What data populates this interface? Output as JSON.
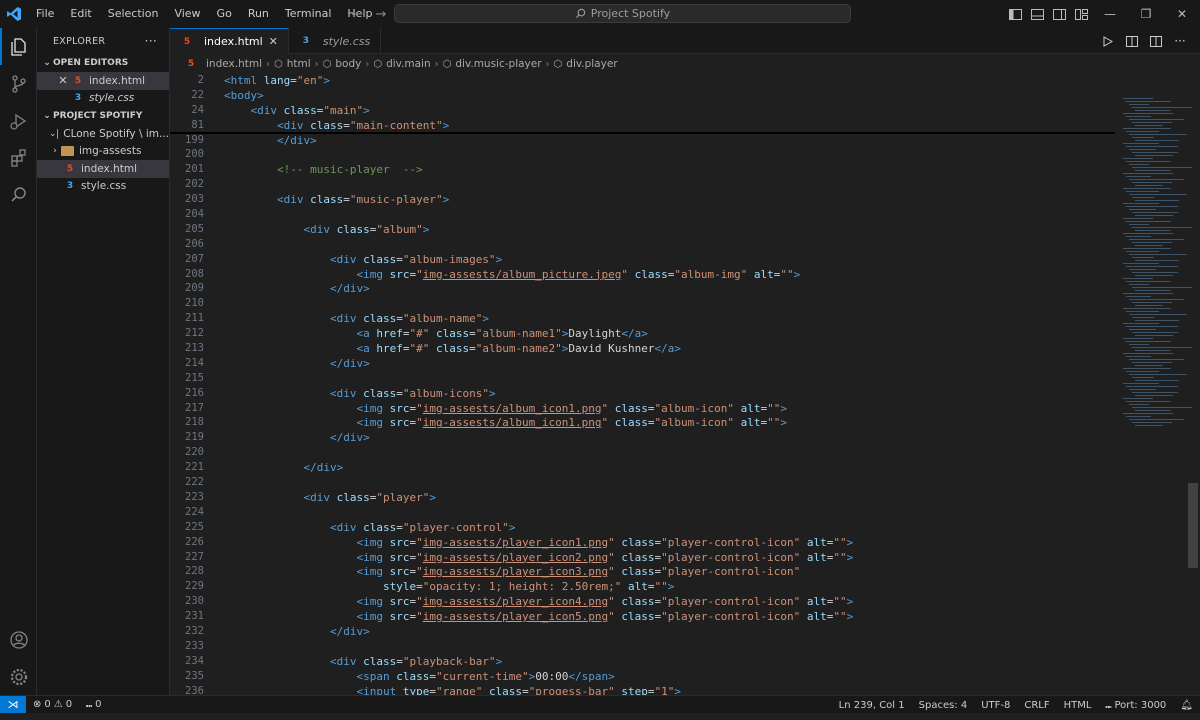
{
  "window": {
    "search_text": "Project Spotify",
    "menu": [
      "File",
      "Edit",
      "Selection",
      "View",
      "Go",
      "Run",
      "Terminal",
      "Help"
    ]
  },
  "sidebar": {
    "header": "EXPLORER",
    "open_editors_label": "OPEN EDITORS",
    "open_editors": [
      {
        "name": "index.html",
        "type": "html"
      },
      {
        "name": "style.css",
        "type": "css"
      }
    ],
    "project_label": "PROJECT SPOTIFY",
    "tree": [
      {
        "name": "CLone Spotify \\ im...",
        "type": "folder",
        "expanded": true
      },
      {
        "name": "img-assests",
        "type": "folder",
        "expanded": false
      },
      {
        "name": "index.html",
        "type": "html"
      },
      {
        "name": "style.css",
        "type": "css"
      }
    ]
  },
  "tabs": [
    {
      "label": "index.html",
      "active": true
    },
    {
      "label": "style.css",
      "active": false
    }
  ],
  "breadcrumbs": [
    "index.html",
    "html",
    "body",
    "div.main",
    "div.music-player",
    "div.player"
  ],
  "status": {
    "errors": "0",
    "warnings": "0",
    "ports": "0",
    "position": "Ln 239, Col 1",
    "spaces": "Spaces: 4",
    "encoding": "UTF-8",
    "eol": "CRLF",
    "language": "HTML",
    "port": "Port: 3000"
  },
  "colors": {
    "accent": "#0078d4",
    "tag": "#569cd6",
    "attr": "#9cdcfe",
    "string": "#ce9178",
    "comment": "#6a9955"
  },
  "code_lines": [
    {
      "n": "2",
      "sticky": true,
      "parts": [
        [
          "tg",
          "<html"
        ],
        [
          "tx",
          " "
        ],
        [
          "at",
          "lang"
        ],
        [
          "tx",
          "="
        ],
        [
          "st",
          "\"en\""
        ],
        [
          "tg",
          ">"
        ]
      ]
    },
    {
      "n": "22",
      "sticky": true,
      "parts": [
        [
          "tg",
          "<body>"
        ]
      ]
    },
    {
      "n": "24",
      "sticky": true,
      "parts": [
        [
          "tx",
          "    "
        ],
        [
          "tg",
          "<div"
        ],
        [
          "tx",
          " "
        ],
        [
          "at",
          "class"
        ],
        [
          "tx",
          "="
        ],
        [
          "st",
          "\"main\""
        ],
        [
          "tg",
          ">"
        ]
      ]
    },
    {
      "n": "81",
      "sticky": true,
      "last": true,
      "parts": [
        [
          "tx",
          "        "
        ],
        [
          "tg",
          "<div"
        ],
        [
          "tx",
          " "
        ],
        [
          "at",
          "class"
        ],
        [
          "tx",
          "="
        ],
        [
          "st",
          "\"main-content\""
        ],
        [
          "tg",
          ">"
        ]
      ]
    },
    {
      "n": "199",
      "parts": [
        [
          "tx",
          "        "
        ],
        [
          "tg",
          "</div>"
        ]
      ]
    },
    {
      "n": "200",
      "parts": []
    },
    {
      "n": "201",
      "parts": [
        [
          "tx",
          "        "
        ],
        [
          "cm",
          "<!-- music-player  -->"
        ]
      ]
    },
    {
      "n": "202",
      "parts": []
    },
    {
      "n": "203",
      "parts": [
        [
          "tx",
          "        "
        ],
        [
          "tg",
          "<div"
        ],
        [
          "tx",
          " "
        ],
        [
          "at",
          "class"
        ],
        [
          "tx",
          "="
        ],
        [
          "st",
          "\"music-player\""
        ],
        [
          "tg",
          ">"
        ]
      ]
    },
    {
      "n": "204",
      "parts": []
    },
    {
      "n": "205",
      "parts": [
        [
          "tx",
          "            "
        ],
        [
          "tg",
          "<div"
        ],
        [
          "tx",
          " "
        ],
        [
          "at",
          "class"
        ],
        [
          "tx",
          "="
        ],
        [
          "st",
          "\"album\""
        ],
        [
          "tg",
          ">"
        ]
      ]
    },
    {
      "n": "206",
      "parts": []
    },
    {
      "n": "207",
      "parts": [
        [
          "tx",
          "                "
        ],
        [
          "tg",
          "<div"
        ],
        [
          "tx",
          " "
        ],
        [
          "at",
          "class"
        ],
        [
          "tx",
          "="
        ],
        [
          "st",
          "\"album-images\""
        ],
        [
          "tg",
          ">"
        ]
      ]
    },
    {
      "n": "208",
      "parts": [
        [
          "tx",
          "                    "
        ],
        [
          "tg",
          "<img"
        ],
        [
          "tx",
          " "
        ],
        [
          "at",
          "src"
        ],
        [
          "tx",
          "="
        ],
        [
          "st",
          "\""
        ],
        [
          "stu",
          "img-assests/album_picture.jpeg"
        ],
        [
          "st",
          "\""
        ],
        [
          "tx",
          " "
        ],
        [
          "at",
          "class"
        ],
        [
          "tx",
          "="
        ],
        [
          "st",
          "\"album-img\""
        ],
        [
          "tx",
          " "
        ],
        [
          "at",
          "alt"
        ],
        [
          "tx",
          "="
        ],
        [
          "st",
          "\"\""
        ],
        [
          "tg",
          ">"
        ]
      ]
    },
    {
      "n": "209",
      "parts": [
        [
          "tx",
          "                "
        ],
        [
          "tg",
          "</div>"
        ]
      ]
    },
    {
      "n": "210",
      "parts": []
    },
    {
      "n": "211",
      "parts": [
        [
          "tx",
          "                "
        ],
        [
          "tg",
          "<div"
        ],
        [
          "tx",
          " "
        ],
        [
          "at",
          "class"
        ],
        [
          "tx",
          "="
        ],
        [
          "st",
          "\"album-name\""
        ],
        [
          "tg",
          ">"
        ]
      ]
    },
    {
      "n": "212",
      "parts": [
        [
          "tx",
          "                    "
        ],
        [
          "tg",
          "<a"
        ],
        [
          "tx",
          " "
        ],
        [
          "at",
          "href"
        ],
        [
          "tx",
          "="
        ],
        [
          "st",
          "\"#\""
        ],
        [
          "tx",
          " "
        ],
        [
          "at",
          "class"
        ],
        [
          "tx",
          "="
        ],
        [
          "st",
          "\"album-name1\""
        ],
        [
          "tg",
          ">"
        ],
        [
          "tx",
          "Daylight"
        ],
        [
          "tg",
          "</a>"
        ]
      ]
    },
    {
      "n": "213",
      "parts": [
        [
          "tx",
          "                    "
        ],
        [
          "tg",
          "<a"
        ],
        [
          "tx",
          " "
        ],
        [
          "at",
          "href"
        ],
        [
          "tx",
          "="
        ],
        [
          "st",
          "\"#\""
        ],
        [
          "tx",
          " "
        ],
        [
          "at",
          "class"
        ],
        [
          "tx",
          "="
        ],
        [
          "st",
          "\"album-name2\""
        ],
        [
          "tg",
          ">"
        ],
        [
          "tx",
          "David Kushner"
        ],
        [
          "tg",
          "</a>"
        ]
      ]
    },
    {
      "n": "214",
      "parts": [
        [
          "tx",
          "                "
        ],
        [
          "tg",
          "</div>"
        ]
      ]
    },
    {
      "n": "215",
      "parts": []
    },
    {
      "n": "216",
      "parts": [
        [
          "tx",
          "                "
        ],
        [
          "tg",
          "<div"
        ],
        [
          "tx",
          " "
        ],
        [
          "at",
          "class"
        ],
        [
          "tx",
          "="
        ],
        [
          "st",
          "\"album-icons\""
        ],
        [
          "tg",
          ">"
        ]
      ]
    },
    {
      "n": "217",
      "parts": [
        [
          "tx",
          "                    "
        ],
        [
          "tg",
          "<img"
        ],
        [
          "tx",
          " "
        ],
        [
          "at",
          "src"
        ],
        [
          "tx",
          "="
        ],
        [
          "st",
          "\""
        ],
        [
          "stu",
          "img-assests/album_icon1.png"
        ],
        [
          "st",
          "\""
        ],
        [
          "tx",
          " "
        ],
        [
          "at",
          "class"
        ],
        [
          "tx",
          "="
        ],
        [
          "st",
          "\"album-icon\""
        ],
        [
          "tx",
          " "
        ],
        [
          "at",
          "alt"
        ],
        [
          "tx",
          "="
        ],
        [
          "st",
          "\"\""
        ],
        [
          "tg",
          ">"
        ]
      ]
    },
    {
      "n": "218",
      "parts": [
        [
          "tx",
          "                    "
        ],
        [
          "tg",
          "<img"
        ],
        [
          "tx",
          " "
        ],
        [
          "at",
          "src"
        ],
        [
          "tx",
          "="
        ],
        [
          "st",
          "\""
        ],
        [
          "stu",
          "img-assests/album_icon1.png"
        ],
        [
          "st",
          "\""
        ],
        [
          "tx",
          " "
        ],
        [
          "at",
          "class"
        ],
        [
          "tx",
          "="
        ],
        [
          "st",
          "\"album-icon\""
        ],
        [
          "tx",
          " "
        ],
        [
          "at",
          "alt"
        ],
        [
          "tx",
          "="
        ],
        [
          "st",
          "\"\""
        ],
        [
          "tg",
          ">"
        ]
      ]
    },
    {
      "n": "219",
      "parts": [
        [
          "tx",
          "                "
        ],
        [
          "tg",
          "</div>"
        ]
      ]
    },
    {
      "n": "220",
      "parts": []
    },
    {
      "n": "221",
      "parts": [
        [
          "tx",
          "            "
        ],
        [
          "tg",
          "</div>"
        ]
      ]
    },
    {
      "n": "222",
      "parts": []
    },
    {
      "n": "223",
      "parts": [
        [
          "tx",
          "            "
        ],
        [
          "tg",
          "<div"
        ],
        [
          "tx",
          " "
        ],
        [
          "at",
          "class"
        ],
        [
          "tx",
          "="
        ],
        [
          "st",
          "\"player\""
        ],
        [
          "tg",
          ">"
        ]
      ]
    },
    {
      "n": "224",
      "parts": []
    },
    {
      "n": "225",
      "parts": [
        [
          "tx",
          "                "
        ],
        [
          "tg",
          "<div"
        ],
        [
          "tx",
          " "
        ],
        [
          "at",
          "class"
        ],
        [
          "tx",
          "="
        ],
        [
          "st",
          "\"player-control\""
        ],
        [
          "tg",
          ">"
        ]
      ]
    },
    {
      "n": "226",
      "parts": [
        [
          "tx",
          "                    "
        ],
        [
          "tg",
          "<img"
        ],
        [
          "tx",
          " "
        ],
        [
          "at",
          "src"
        ],
        [
          "tx",
          "="
        ],
        [
          "st",
          "\""
        ],
        [
          "stu",
          "img-assests/player_icon1.png"
        ],
        [
          "st",
          "\""
        ],
        [
          "tx",
          " "
        ],
        [
          "at",
          "class"
        ],
        [
          "tx",
          "="
        ],
        [
          "st",
          "\"player-control-icon\""
        ],
        [
          "tx",
          " "
        ],
        [
          "at",
          "alt"
        ],
        [
          "tx",
          "="
        ],
        [
          "st",
          "\"\""
        ],
        [
          "tg",
          ">"
        ]
      ]
    },
    {
      "n": "227",
      "parts": [
        [
          "tx",
          "                    "
        ],
        [
          "tg",
          "<img"
        ],
        [
          "tx",
          " "
        ],
        [
          "at",
          "src"
        ],
        [
          "tx",
          "="
        ],
        [
          "st",
          "\""
        ],
        [
          "stu",
          "img-assests/player_icon2.png"
        ],
        [
          "st",
          "\""
        ],
        [
          "tx",
          " "
        ],
        [
          "at",
          "class"
        ],
        [
          "tx",
          "="
        ],
        [
          "st",
          "\"player-control-icon\""
        ],
        [
          "tx",
          " "
        ],
        [
          "at",
          "alt"
        ],
        [
          "tx",
          "="
        ],
        [
          "st",
          "\"\""
        ],
        [
          "tg",
          ">"
        ]
      ]
    },
    {
      "n": "228",
      "parts": [
        [
          "tx",
          "                    "
        ],
        [
          "tg",
          "<img"
        ],
        [
          "tx",
          " "
        ],
        [
          "at",
          "src"
        ],
        [
          "tx",
          "="
        ],
        [
          "st",
          "\""
        ],
        [
          "stu",
          "img-assests/player_icon3.png"
        ],
        [
          "st",
          "\""
        ],
        [
          "tx",
          " "
        ],
        [
          "at",
          "class"
        ],
        [
          "tx",
          "="
        ],
        [
          "st",
          "\"player-control-icon\""
        ]
      ]
    },
    {
      "n": "229",
      "parts": [
        [
          "tx",
          "                        "
        ],
        [
          "at",
          "style"
        ],
        [
          "tx",
          "="
        ],
        [
          "st",
          "\"opacity: 1; height: 2.50rem;\""
        ],
        [
          "tx",
          " "
        ],
        [
          "at",
          "alt"
        ],
        [
          "tx",
          "="
        ],
        [
          "st",
          "\"\""
        ],
        [
          "tg",
          ">"
        ]
      ]
    },
    {
      "n": "230",
      "parts": [
        [
          "tx",
          "                    "
        ],
        [
          "tg",
          "<img"
        ],
        [
          "tx",
          " "
        ],
        [
          "at",
          "src"
        ],
        [
          "tx",
          "="
        ],
        [
          "st",
          "\""
        ],
        [
          "stu",
          "img-assests/player_icon4.png"
        ],
        [
          "st",
          "\""
        ],
        [
          "tx",
          " "
        ],
        [
          "at",
          "class"
        ],
        [
          "tx",
          "="
        ],
        [
          "st",
          "\"player-control-icon\""
        ],
        [
          "tx",
          " "
        ],
        [
          "at",
          "alt"
        ],
        [
          "tx",
          "="
        ],
        [
          "st",
          "\"\""
        ],
        [
          "tg",
          ">"
        ]
      ]
    },
    {
      "n": "231",
      "parts": [
        [
          "tx",
          "                    "
        ],
        [
          "tg",
          "<img"
        ],
        [
          "tx",
          " "
        ],
        [
          "at",
          "src"
        ],
        [
          "tx",
          "="
        ],
        [
          "st",
          "\""
        ],
        [
          "stu",
          "img-assests/player_icon5.png"
        ],
        [
          "st",
          "\""
        ],
        [
          "tx",
          " "
        ],
        [
          "at",
          "class"
        ],
        [
          "tx",
          "="
        ],
        [
          "st",
          "\"player-control-icon\""
        ],
        [
          "tx",
          " "
        ],
        [
          "at",
          "alt"
        ],
        [
          "tx",
          "="
        ],
        [
          "st",
          "\"\""
        ],
        [
          "tg",
          ">"
        ]
      ]
    },
    {
      "n": "232",
      "parts": [
        [
          "tx",
          "                "
        ],
        [
          "tg",
          "</div>"
        ]
      ]
    },
    {
      "n": "233",
      "parts": []
    },
    {
      "n": "234",
      "parts": [
        [
          "tx",
          "                "
        ],
        [
          "tg",
          "<div"
        ],
        [
          "tx",
          " "
        ],
        [
          "at",
          "class"
        ],
        [
          "tx",
          "="
        ],
        [
          "st",
          "\"playback-bar\""
        ],
        [
          "tg",
          ">"
        ]
      ]
    },
    {
      "n": "235",
      "parts": [
        [
          "tx",
          "                    "
        ],
        [
          "tg",
          "<span"
        ],
        [
          "tx",
          " "
        ],
        [
          "at",
          "class"
        ],
        [
          "tx",
          "="
        ],
        [
          "st",
          "\"current-time\""
        ],
        [
          "tg",
          ">"
        ],
        [
          "tx",
          "00:00"
        ],
        [
          "tg",
          "</span>"
        ]
      ]
    },
    {
      "n": "236",
      "parts": [
        [
          "tx",
          "                    "
        ],
        [
          "tg",
          "<input"
        ],
        [
          "tx",
          " "
        ],
        [
          "at",
          "type"
        ],
        [
          "tx",
          "="
        ],
        [
          "st",
          "\"range\""
        ],
        [
          "tx",
          " "
        ],
        [
          "at",
          "class"
        ],
        [
          "tx",
          "="
        ],
        [
          "st",
          "\"progess-bar\""
        ],
        [
          "tx",
          " "
        ],
        [
          "at",
          "step"
        ],
        [
          "tx",
          "="
        ],
        [
          "st",
          "\"1\""
        ],
        [
          "tg",
          ">"
        ]
      ]
    }
  ]
}
